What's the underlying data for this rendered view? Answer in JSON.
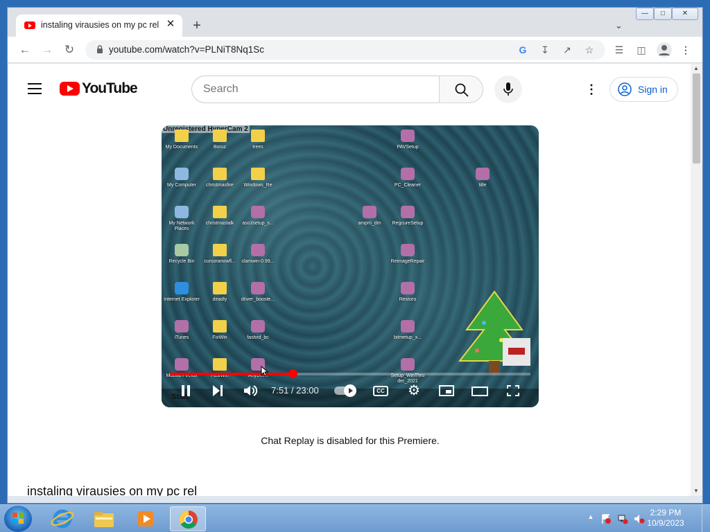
{
  "browser": {
    "tab_title": "instaling virausies on my pc rel -",
    "tab_close": "✕",
    "new_tab": "+",
    "url": "youtube.com/watch?v=PLNiT8Nq1Sc"
  },
  "youtube": {
    "wordmark": "YouTube",
    "search_placeholder": "Search",
    "sign_in": "Sign in"
  },
  "video": {
    "overlay_text": "Unregistered HyperCam 2",
    "time_current": "7:51",
    "time_total": "23:00",
    "time_display": "7:51 / 23:00",
    "progress_fraction": 0.3413,
    "cc_label": "CC",
    "desktop_icons": [
      {
        "label": "My Documents",
        "kind": "folder"
      },
      {
        "label": "Boruz",
        "kind": "folder"
      },
      {
        "label": "trees",
        "kind": "folder"
      },
      {
        "label": "PAVSetup",
        "kind": "app"
      },
      {
        "label": "My Computer",
        "kind": "computer"
      },
      {
        "label": "christmasfire",
        "kind": "folder"
      },
      {
        "label": "Windows_Re",
        "kind": "folder"
      },
      {
        "label": "PC_Cleaner",
        "kind": "app"
      },
      {
        "label": "title",
        "kind": "app"
      },
      {
        "label": "My Network Places",
        "kind": "computer"
      },
      {
        "label": "christmastalk",
        "kind": "folder"
      },
      {
        "label": "aso3setup_s...",
        "kind": "app"
      },
      {
        "label": "ampm_dm",
        "kind": "app"
      },
      {
        "label": "RegcureSetup",
        "kind": "app"
      },
      {
        "label": "Recycle Bin",
        "kind": "bin"
      },
      {
        "label": "cursoranowfl...",
        "kind": "folder"
      },
      {
        "label": "clamwin-0.99...",
        "kind": "app"
      },
      {
        "label": "ReimageRepair",
        "kind": "app"
      },
      {
        "label": "Internet Explorer",
        "kind": "ie"
      },
      {
        "label": "deadly",
        "kind": "folder"
      },
      {
        "label": "driver_booste...",
        "kind": "app"
      },
      {
        "label": "Restoro",
        "kind": "app"
      },
      {
        "label": "iTunes",
        "kind": "app"
      },
      {
        "label": "FixWin",
        "kind": "folder"
      },
      {
        "label": "fastvid_bc",
        "kind": "app"
      },
      {
        "label": "bitmetup_x...",
        "kind": "app"
      },
      {
        "label": "Mozilla Firefox",
        "kind": "app"
      },
      {
        "label": "FastWin",
        "kind": "folder"
      },
      {
        "label": "AnyDesk",
        "kind": "app"
      },
      {
        "label": "Setup_WinThru der_2021",
        "kind": "app"
      }
    ],
    "taskbar_start": "Start"
  },
  "page": {
    "chat_replay": "Chat Replay is disabled for this Premiere.",
    "title": "instaling virausies on my pc rel"
  },
  "taskbar": {
    "time": "2:29 PM",
    "date": "10/9/2023"
  },
  "colors": {
    "youtube_red": "#ff0000",
    "link_blue": "#065fd4",
    "taskbar_blue": "#6e9bd0"
  }
}
